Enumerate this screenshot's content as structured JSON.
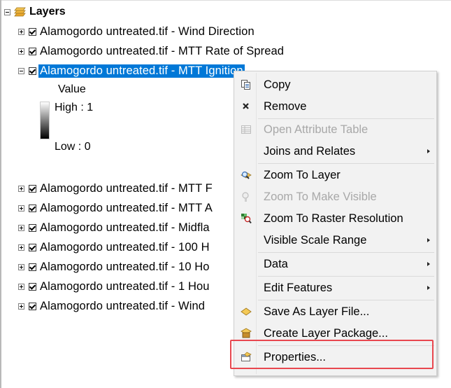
{
  "toc": {
    "root_title": "Layers",
    "layers": [
      {
        "label": "Alamogordo untreated.tif - Wind Direction",
        "expanded": false,
        "checked": true
      },
      {
        "label": "Alamogordo untreated.tif - MTT Rate of Spread",
        "expanded": false,
        "checked": true
      },
      {
        "label": "Alamogordo untreated.tif - MTT Ignition",
        "expanded": true,
        "checked": true,
        "selected": true
      },
      {
        "label": "Alamogordo untreated.tif - MTT F",
        "expanded": false,
        "checked": true
      },
      {
        "label": "Alamogordo untreated.tif - MTT A",
        "expanded": false,
        "checked": true
      },
      {
        "label": "Alamogordo untreated.tif - Midfla",
        "expanded": false,
        "checked": true
      },
      {
        "label": "Alamogordo untreated.tif - 100 H",
        "expanded": false,
        "checked": true
      },
      {
        "label": "Alamogordo untreated.tif - 10 Ho",
        "expanded": false,
        "checked": true
      },
      {
        "label": "Alamogordo untreated.tif - 1 Hou",
        "expanded": false,
        "checked": true
      },
      {
        "label": "Alamogordo untreated.tif - Wind",
        "expanded": false,
        "checked": true
      }
    ],
    "legend": {
      "heading": "Value",
      "high": "High : 1",
      "low": "Low : 0"
    }
  },
  "context_menu": {
    "items": [
      {
        "label": "Copy",
        "icon": "copy-icon",
        "enabled": true,
        "submenu": false
      },
      {
        "label": "Remove",
        "icon": "remove-icon",
        "enabled": true,
        "submenu": false
      },
      {
        "label": "Open Attribute Table",
        "icon": "table-icon",
        "enabled": false,
        "submenu": false
      },
      {
        "label": "Joins and Relates",
        "icon": "",
        "enabled": true,
        "submenu": true
      },
      {
        "label": "Zoom To Layer",
        "icon": "zoom-to-layer-icon",
        "enabled": true,
        "submenu": false
      },
      {
        "label": "Zoom To Make Visible",
        "icon": "zoom-to-make-visible-icon",
        "enabled": false,
        "submenu": false
      },
      {
        "label": "Zoom To Raster Resolution",
        "icon": "zoom-to-raster-icon",
        "enabled": true,
        "submenu": false
      },
      {
        "label": "Visible Scale Range",
        "icon": "",
        "enabled": true,
        "submenu": true
      },
      {
        "label": "Data",
        "icon": "",
        "enabled": true,
        "submenu": true
      },
      {
        "label": "Edit Features",
        "icon": "",
        "enabled": true,
        "submenu": true
      },
      {
        "label": "Save As Layer File...",
        "icon": "save-layer-file-icon",
        "enabled": true,
        "submenu": false
      },
      {
        "label": "Create Layer Package...",
        "icon": "layer-package-icon",
        "enabled": true,
        "submenu": false
      },
      {
        "label": "Properties...",
        "icon": "properties-icon",
        "enabled": true,
        "submenu": false,
        "highlighted": true
      }
    ]
  },
  "colors": {
    "selection": "#0078d7",
    "highlight_box": "#e8474f",
    "menu_background": "#f2f2f2"
  }
}
